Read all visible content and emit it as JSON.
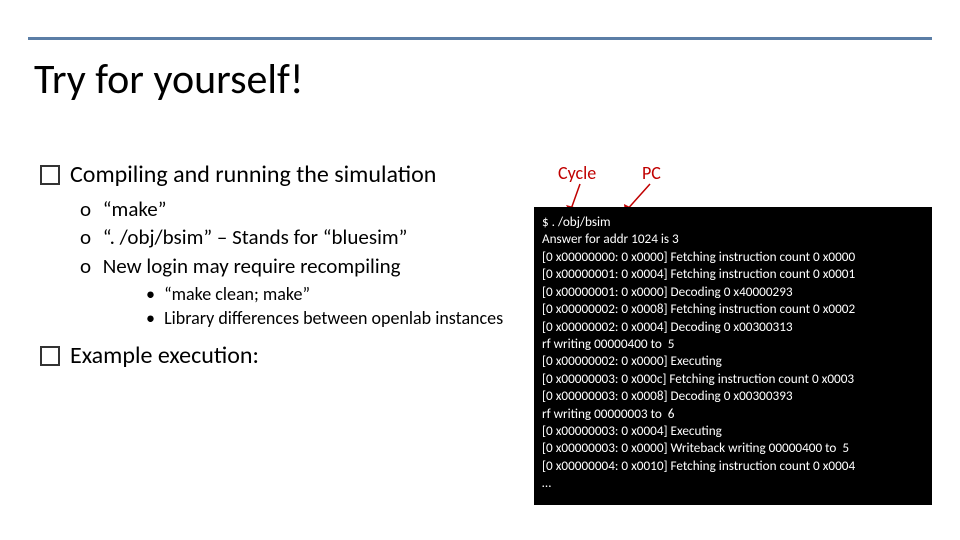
{
  "title": "Try for yourself!",
  "bullets": {
    "q1": "Compiling and running the simulation",
    "q1_items": {
      "o1": "“make”",
      "o2": "“. /obj/bsim” – Stands for “bluesim”",
      "o3": "New login may require recompiling",
      "o3_sub": {
        "b1": "“make clean; make”",
        "b2": "Library differences between openlab instances"
      }
    },
    "q2": "Example execution:"
  },
  "labels": {
    "cycle": "Cycle",
    "pc": "PC"
  },
  "terminal": {
    "lines": [
      "$ . /obj/bsim",
      "Answer for addr 1024 is 3",
      "[0 x00000000: 0 x0000] Fetching instruction count 0 x0000",
      "[0 x00000001: 0 x0004] Fetching instruction count 0 x0001",
      "[0 x00000001: 0 x0000] Decoding 0 x40000293",
      "[0 x00000002: 0 x0008] Fetching instruction count 0 x0002",
      "[0 x00000002: 0 x0004] Decoding 0 x00300313",
      "rf writing 00000400 to  5",
      "[0 x00000002: 0 x0000] Executing",
      "[0 x00000003: 0 x000c] Fetching instruction count 0 x0003",
      "[0 x00000003: 0 x0008] Decoding 0 x00300393",
      "rf writing 00000003 to  6",
      "[0 x00000003: 0 x0004] Executing",
      "[0 x00000003: 0 x0000] Writeback writing 00000400 to  5",
      "[0 x00000004: 0 x0010] Fetching instruction count 0 x0004",
      "…"
    ]
  }
}
